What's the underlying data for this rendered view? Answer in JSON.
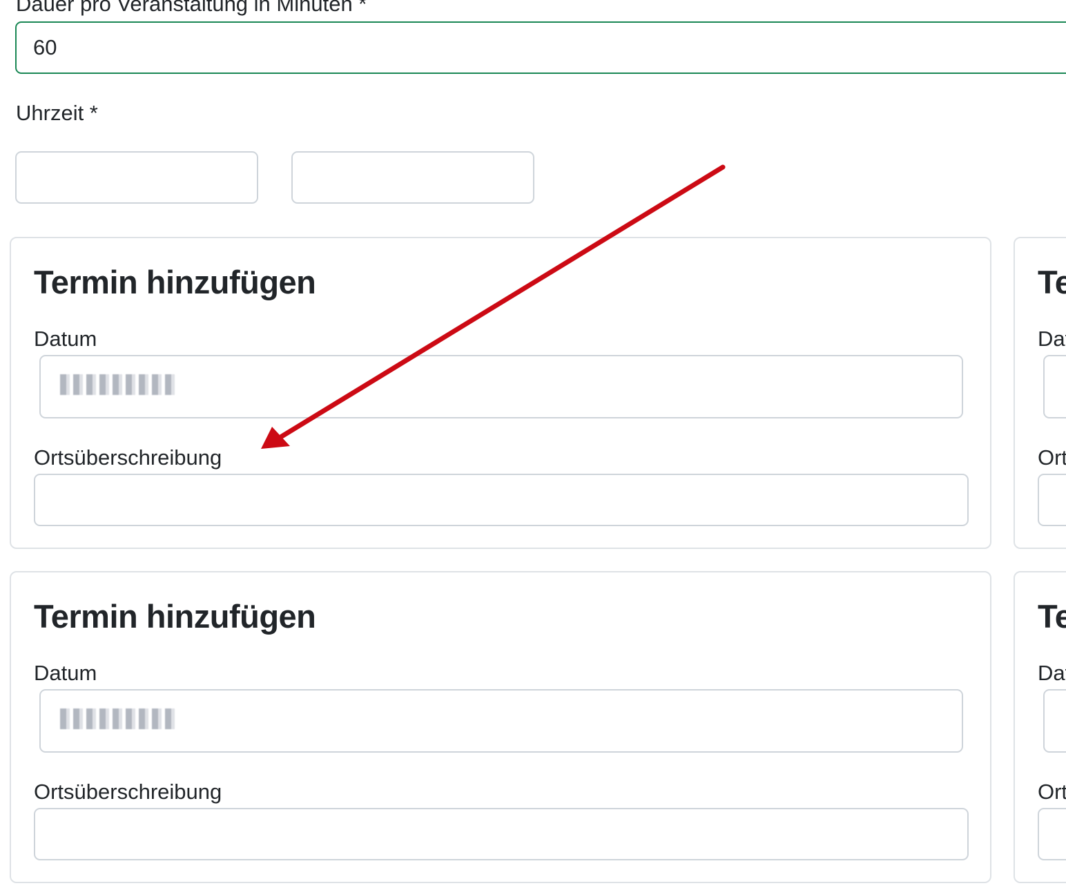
{
  "form": {
    "duration": {
      "label": "Dauer pro Veranstaltung in Minuten *",
      "value": "60"
    },
    "time": {
      "label": "Uhrzeit *",
      "start_value": "",
      "end_value": ""
    }
  },
  "cards": [
    {
      "title": "Termin hinzufügen",
      "date_label": "Datum",
      "location_label": "Ortsüberschreibung",
      "location_value": ""
    },
    {
      "title": "Termin hinzufügen",
      "date_label": "Datum",
      "location_label": "Ortsüberschreibung",
      "location_value": ""
    }
  ],
  "right_cards": [
    {
      "title_fragment": "Te",
      "date_label_fragment": "Dat",
      "location_label_fragment": "Ort"
    },
    {
      "title_fragment": "Te",
      "date_label_fragment": "Dat",
      "location_label_fragment": "Ort"
    }
  ],
  "annotation": {
    "arrow_color": "#cc0a14"
  },
  "colors": {
    "valid_border": "#198754",
    "input_border": "#ced4da",
    "card_border": "#dee2e6"
  }
}
